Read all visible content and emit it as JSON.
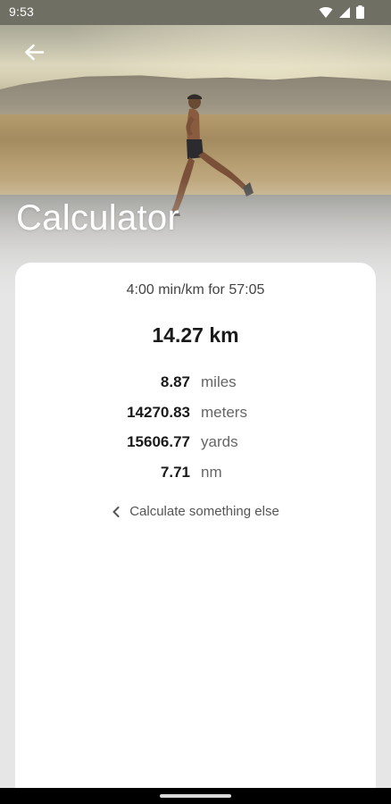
{
  "status_bar": {
    "time": "9:53"
  },
  "header": {
    "back_icon": "arrow-left-icon",
    "title": "Calculator"
  },
  "result": {
    "summary": "4:00 min/km for 57:05",
    "distance": "14.27 km",
    "conversions": [
      {
        "value": "8.87",
        "unit": "miles"
      },
      {
        "value": "14270.83",
        "unit": "meters"
      },
      {
        "value": "15606.77",
        "unit": "yards"
      },
      {
        "value": "7.71",
        "unit": "nm"
      }
    ],
    "calculate_again_label": "Calculate something else",
    "calculate_again_icon": "chevron-left-icon"
  },
  "colors": {
    "card_background": "#ffffff",
    "page_background": "#e6e6e6",
    "title_text": "#ffffff",
    "primary_text": "#1a1a1a",
    "secondary_text": "#666666"
  }
}
